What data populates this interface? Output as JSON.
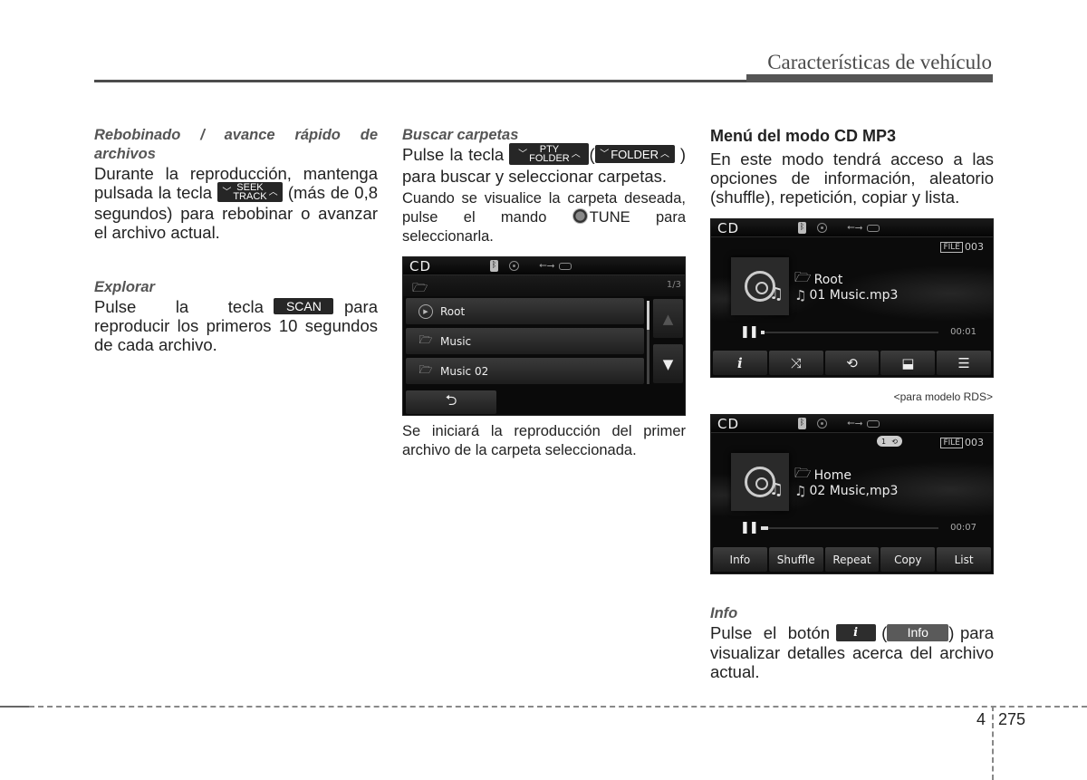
{
  "header": {
    "title": "Características de vehículo"
  },
  "col1": {
    "rewind_heading": "Rebobinado / avance rápido de archivos",
    "rewind_text_1": "Durante la reproducción, mantenga pulsada la tecla",
    "rewind_text_2": "(más de 0,8 segundos) para rebobinar o avanzar el archivo actual.",
    "seek_key": {
      "top": "SEEK",
      "bottom": "TRACK"
    },
    "scan_heading": "Explorar",
    "scan_text_1": "Pulse la tecla",
    "scan_text_2": "para reproducir los primeros 10 segundos de cada archivo.",
    "scan_key": "SCAN"
  },
  "col2": {
    "folder_heading": "Buscar carpetas",
    "folder_text_1": "Pulse la tecla",
    "folder_text_2": "(",
    "folder_text_3": ") para buscar y seleccionar carpetas.",
    "pty_key": {
      "top": "PTY",
      "bottom": "FOLDER"
    },
    "folder_key": "FOLDER",
    "tune_text_1": "Cuando se visualice la carpeta deseada, pulse el mando",
    "tune_label": "TUNE",
    "tune_text_2": "para seleccionarla.",
    "after_text": "Se iniciará la reproducción del primer archivo de la carpeta seleccionada."
  },
  "folder_screen": {
    "mode": "CD",
    "page": "1/3",
    "items": [
      {
        "label": "Root",
        "icon": "play-circle-icon"
      },
      {
        "label": "Music",
        "icon": "folder-icon"
      },
      {
        "label": "Music 02",
        "icon": "folder-icon"
      }
    ],
    "up_arrow": "▲",
    "down_arrow": "▼",
    "back_glyph": "⮌"
  },
  "col3": {
    "menu_heading": "Menú del modo CD MP3",
    "menu_text": "En este modo tendrá acceso a las opciones de información, aleatorio (shuffle), repetición, copiar y lista.",
    "caption": "<para modelo RDS>",
    "info_heading": "Info",
    "info_text_1": "Pulse el botón",
    "info_text_2": "(",
    "info_text_3": ") para visualizar detalles acerca del archivo actual.",
    "i_key": "i",
    "info_key": "Info"
  },
  "player_screen_1": {
    "mode": "CD",
    "file_label": "FILE",
    "file_number": "003",
    "folder": "Root",
    "track": "01 Music.mp3",
    "time": "00:01",
    "progress": 0.02,
    "buttons": [
      {
        "name": "info",
        "glyph": "i"
      },
      {
        "name": "shuffle",
        "glyph": "⤨"
      },
      {
        "name": "repeat",
        "glyph": "⟲"
      },
      {
        "name": "copy",
        "glyph": "⬓"
      },
      {
        "name": "list",
        "glyph": "☰"
      }
    ]
  },
  "player_screen_2": {
    "mode": "CD",
    "repeat_badge": "1",
    "file_label": "FILE",
    "file_number": "003",
    "folder": "Home",
    "track": "02 Music,mp3",
    "time": "00:07",
    "progress": 0.04,
    "buttons": [
      "Info",
      "Shuffle",
      "Repeat",
      "Copy",
      "List"
    ]
  },
  "footer": {
    "chapter": "4",
    "page": "275"
  }
}
